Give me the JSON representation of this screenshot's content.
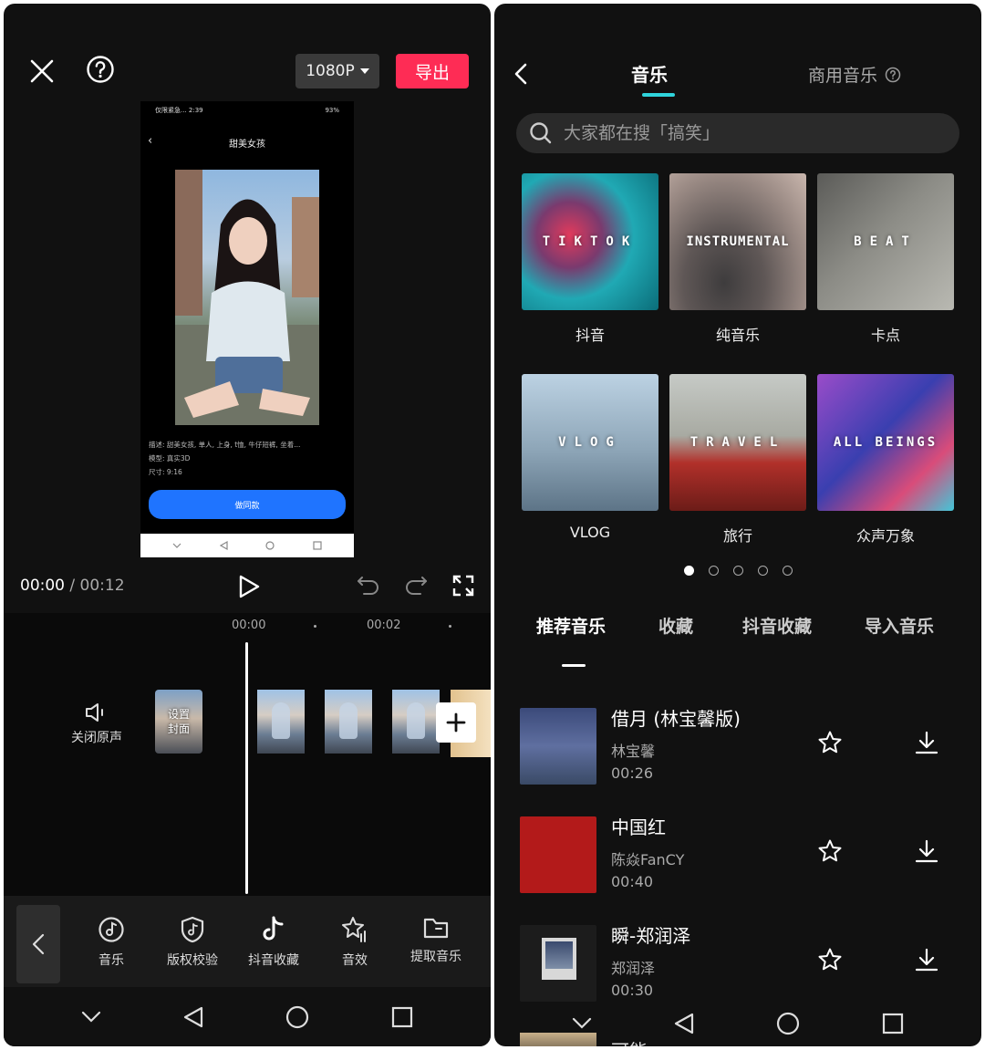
{
  "editor": {
    "resolution_label": "1080P",
    "export_label": "导出",
    "preview": {
      "status_left": "仅限紧急... 2:39",
      "status_right": "93%",
      "title": "甜美女孩",
      "desc_line1": "描述:  甜美女孩, 单人, 上身, t恤, 牛仔短裤, 坐着...",
      "desc_line2": "模型:  真实3D",
      "desc_line3": "尺寸:  9:16",
      "button_label": "做同款"
    },
    "time_current": "00:00",
    "time_separator": " / ",
    "time_total": "00:12",
    "timeline": {
      "tick_0": "00:00",
      "tick_1": "00:02",
      "mute_label": "关闭原声",
      "cover_label": "设置封面"
    },
    "toolbar": {
      "items": [
        {
          "label": "音乐",
          "icon": "music-disc-icon"
        },
        {
          "label": "版权校验",
          "icon": "shield-music-icon"
        },
        {
          "label": "抖音收藏",
          "icon": "tiktok-icon"
        },
        {
          "label": "音效",
          "icon": "star-sound-icon"
        },
        {
          "label": "提取音乐",
          "icon": "folder-icon"
        }
      ]
    }
  },
  "music": {
    "tab_music": "音乐",
    "tab_commercial": "商用音乐",
    "search_placeholder": "大家都在搜「搞笑」",
    "categories": [
      {
        "cover_text": "TIKTOK",
        "label": "抖音"
      },
      {
        "cover_text": "INSTRUMENTAL",
        "label": "纯音乐"
      },
      {
        "cover_text": "BEAT",
        "label": "卡点"
      },
      {
        "cover_text": "VLOG",
        "label": "VLOG"
      },
      {
        "cover_text": "TRAVEL",
        "label": "旅行"
      },
      {
        "cover_text": "ALL BEINGS",
        "label": "众声万象"
      }
    ],
    "page_dots": 5,
    "active_dot": 0,
    "tabs": [
      "推荐音乐",
      "收藏",
      "抖音收藏",
      "导入音乐"
    ],
    "active_tab": 0,
    "songs": [
      {
        "title": "借月 (林宝馨版)",
        "artist": "林宝馨",
        "duration": "00:26"
      },
      {
        "title": "中国红",
        "artist": "陈焱FanCY",
        "duration": "00:40"
      },
      {
        "title": "瞬-郑润泽",
        "artist": "郑润泽",
        "duration": "00:30"
      }
    ],
    "peek_song_title": "可能"
  },
  "colors": {
    "export": "#fe2c55",
    "accent_tab": "#2fd4dc",
    "preview_button": "#1f74ff"
  }
}
